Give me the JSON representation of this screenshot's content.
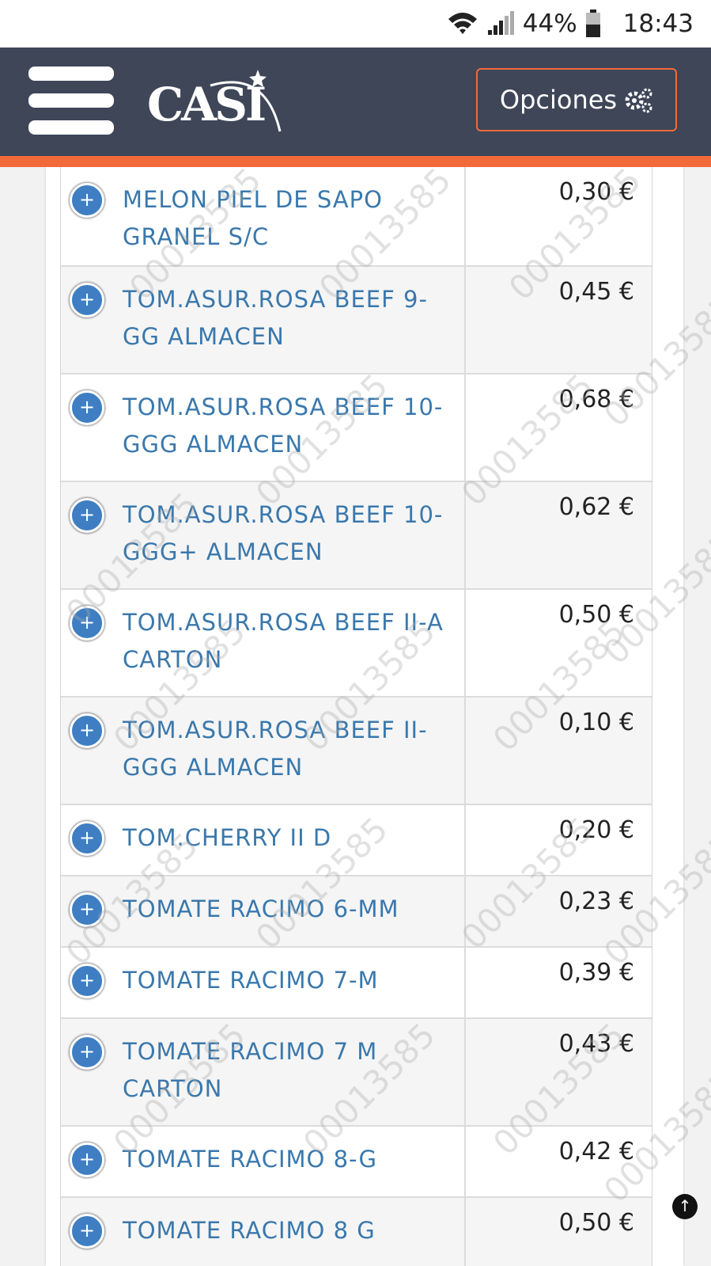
{
  "status_bar": {
    "battery": "44%",
    "time": "18:43"
  },
  "header": {
    "logo_text": "CASI",
    "options_label": "Opciones"
  },
  "watermark_text": "00013585",
  "products": [
    {
      "name": "MELON PIEL DE SAPO GRANEL S/C",
      "price": "0,30 €"
    },
    {
      "name": "TOM.ASUR.ROSA BEEF 9-GG ALMACEN",
      "price": "0,45 €"
    },
    {
      "name": "TOM.ASUR.ROSA BEEF 10-GGG ALMACEN",
      "price": "0,68 €"
    },
    {
      "name": "TOM.ASUR.ROSA BEEF 10-GGG+ ALMACEN",
      "price": "0,62 €"
    },
    {
      "name": "TOM.ASUR.ROSA BEEF II-A CARTON",
      "price": "0,50 €"
    },
    {
      "name": "TOM.ASUR.ROSA BEEF II-GGG ALMACEN",
      "price": "0,10 €"
    },
    {
      "name": "TOM.CHERRY II D",
      "price": "0,20 €"
    },
    {
      "name": "TOMATE RACIMO 6-MM",
      "price": "0,23 €"
    },
    {
      "name": "TOMATE RACIMO 7-M",
      "price": "0,39 €"
    },
    {
      "name": "TOMATE RACIMO 7 M CARTON",
      "price": "0,43 €"
    },
    {
      "name": "TOMATE RACIMO 8-G",
      "price": "0,42 €"
    },
    {
      "name": "TOMATE RACIMO 8 G",
      "price": "0,50 €"
    }
  ]
}
